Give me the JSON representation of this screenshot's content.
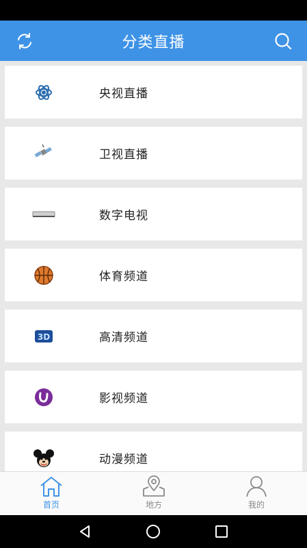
{
  "header": {
    "title": "分类直播",
    "refresh_icon": "refresh-icon",
    "search_icon": "search-icon",
    "background": "#3f93e6"
  },
  "categories": [
    {
      "label": "央视直播",
      "icon": "atom-icon"
    },
    {
      "label": "卫视直播",
      "icon": "satellite-icon"
    },
    {
      "label": "数字电视",
      "icon": "set-top-box-icon"
    },
    {
      "label": "体育频道",
      "icon": "basketball-icon"
    },
    {
      "label": "高清频道",
      "icon": "3d-icon"
    },
    {
      "label": "影视频道",
      "icon": "film-logo-icon"
    },
    {
      "label": "动漫频道",
      "icon": "mickey-icon"
    }
  ],
  "tabs": [
    {
      "label": "首页",
      "icon": "home-icon",
      "active": true
    },
    {
      "label": "地方",
      "icon": "location-icon",
      "active": false
    },
    {
      "label": "我的",
      "icon": "person-icon",
      "active": false
    }
  ],
  "colors": {
    "accent": "#3f93e6",
    "inactive": "#8a8a8a"
  },
  "system_nav": [
    "back-icon",
    "home-circle-icon",
    "recents-icon"
  ]
}
